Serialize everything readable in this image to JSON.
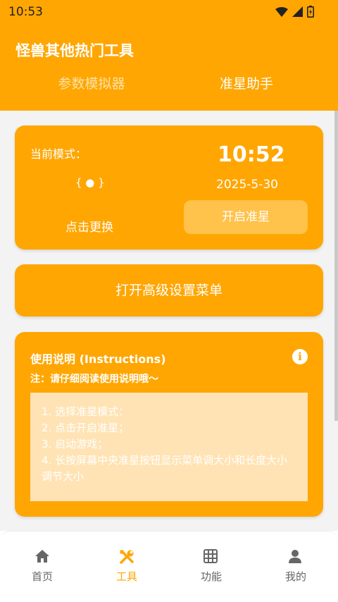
{
  "status_bar": {
    "time": "10:53"
  },
  "header": {
    "title": "怪兽其他热门工具"
  },
  "tabs": [
    {
      "label": "参数模拟器",
      "active": false
    },
    {
      "label": "准星助手",
      "active": true
    }
  ],
  "mode_card": {
    "label": "当前模式：",
    "mode_symbol": "{ ● }",
    "change_button": "点击更换",
    "clock": "10:52",
    "date": "2025-5-30",
    "start_button": "开启准星"
  },
  "menu_card": {
    "label": "打开高级设置菜单"
  },
  "instructions": {
    "title": "使用说明 (Instructions)",
    "note": "注：请仔细阅读使用说明哦～",
    "steps": [
      "1. 选择准星模式：",
      "2. 点击开启准星；",
      "3. 启动游戏；",
      "4. 长按屏幕中央准星按钮显示菜单调大小和长度大小调节大小"
    ]
  },
  "bottom_nav": {
    "items": [
      {
        "label": "首页",
        "icon": "home-icon",
        "active": false
      },
      {
        "label": "工具",
        "icon": "tools-icon",
        "active": true
      },
      {
        "label": "功能",
        "icon": "grid-icon",
        "active": false
      },
      {
        "label": "我的",
        "icon": "person-icon",
        "active": false
      }
    ]
  },
  "colors": {
    "accent": "#FFA602",
    "button_light": "#FFC24A",
    "box_light": "#FFE3B4",
    "tab_inactive": "#FFE2A6"
  }
}
